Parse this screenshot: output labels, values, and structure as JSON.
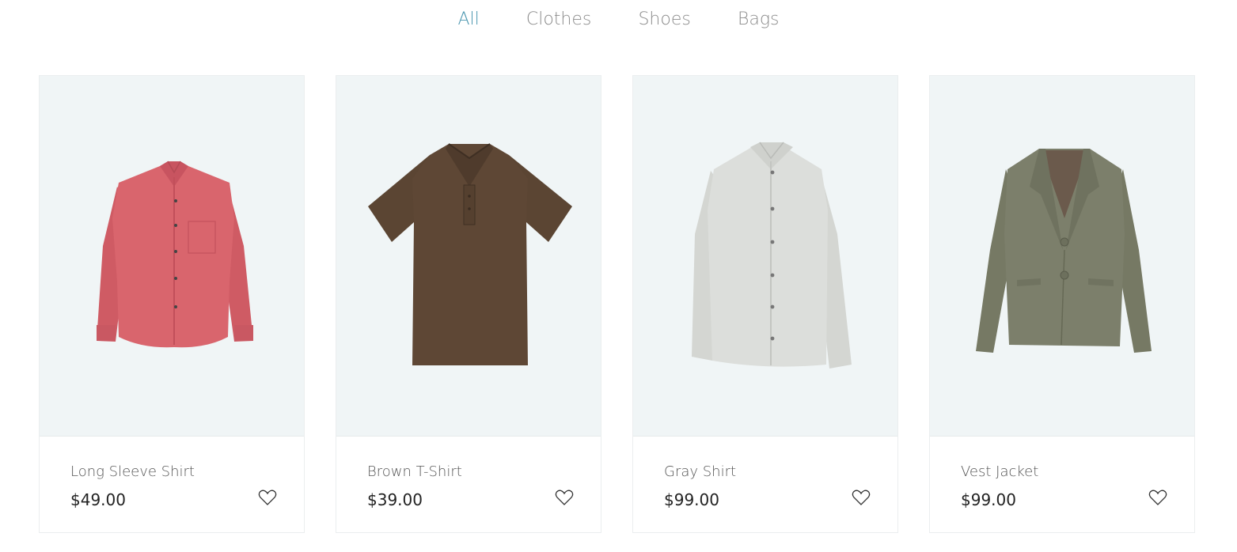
{
  "tabs": [
    {
      "label": "All",
      "active": true
    },
    {
      "label": "Clothes",
      "active": false
    },
    {
      "label": "Shoes",
      "active": false
    },
    {
      "label": "Bags",
      "active": false
    }
  ],
  "products": [
    {
      "name": "Long Sleeve Shirt",
      "price": "$49.00",
      "color": "#d9656d"
    },
    {
      "name": "Brown T-Shirt",
      "price": "$39.00",
      "color": "#5d4634"
    },
    {
      "name": "Gray Shirt",
      "price": "$99.00",
      "color": "#dcdedb"
    },
    {
      "name": "Vest Jacket",
      "price": "$99.00",
      "color": "#7c7f6b"
    }
  ],
  "icons": {
    "wishlist": "heart-outline-icon"
  }
}
